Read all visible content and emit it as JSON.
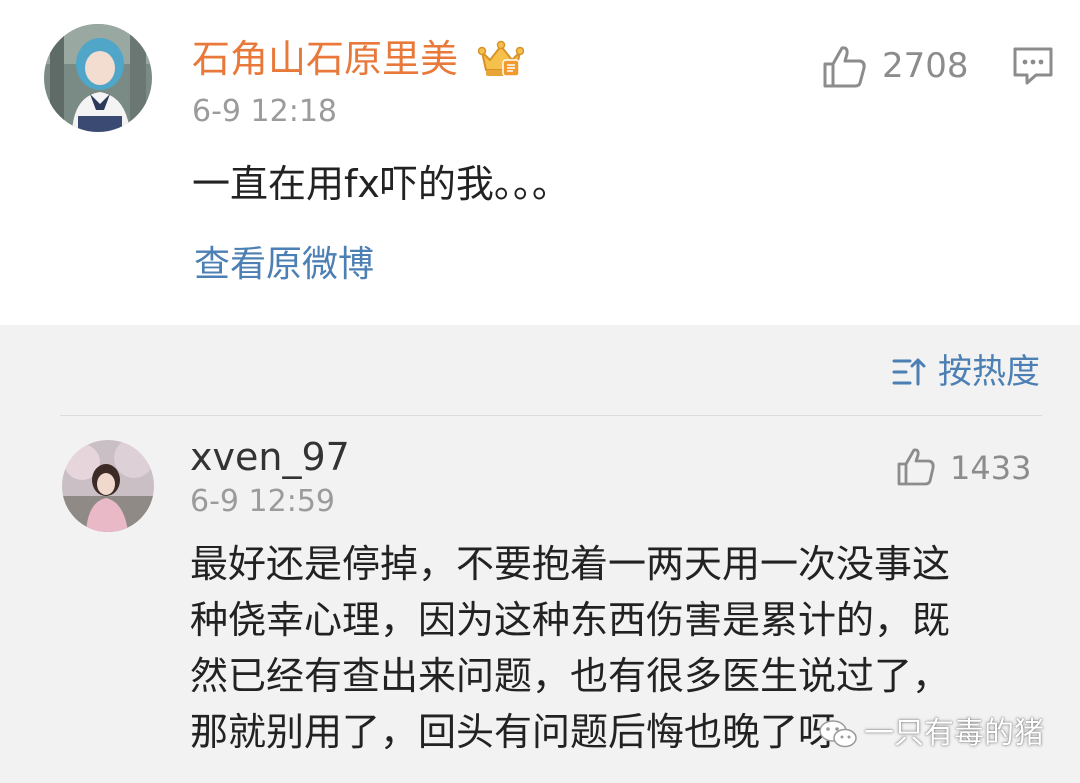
{
  "colors": {
    "username_orange": "#e8793b",
    "link_blue": "#4c7fb3",
    "meta_gray": "#9b9b9b",
    "text_dark": "#222222",
    "page_bg": "#f2f2f2"
  },
  "post": {
    "username": "石角山石原里美",
    "badge_icon": "crown-icon",
    "timestamp": "6-9 12:18",
    "content": "一直在用fx吓的我。。。",
    "like_count": "2708",
    "view_original_label": "查看原微博"
  },
  "sort": {
    "label": "按热度",
    "icon": "sort-icon"
  },
  "reply": {
    "username": "xven_97",
    "timestamp": "6-9 12:59",
    "like_count": "1433",
    "lines": [
      "最好还是停掉，不要抱着一两天用一次没事这",
      "种侥幸心理，因为这种东西伤害是累计的，既",
      "然已经有查出来问题，也有很多医生说过了，",
      "那就别用了，回头有问题后悔也晚了呀"
    ]
  },
  "watermark": {
    "text": "一只有毒的猪",
    "icon": "wechat-icon"
  }
}
